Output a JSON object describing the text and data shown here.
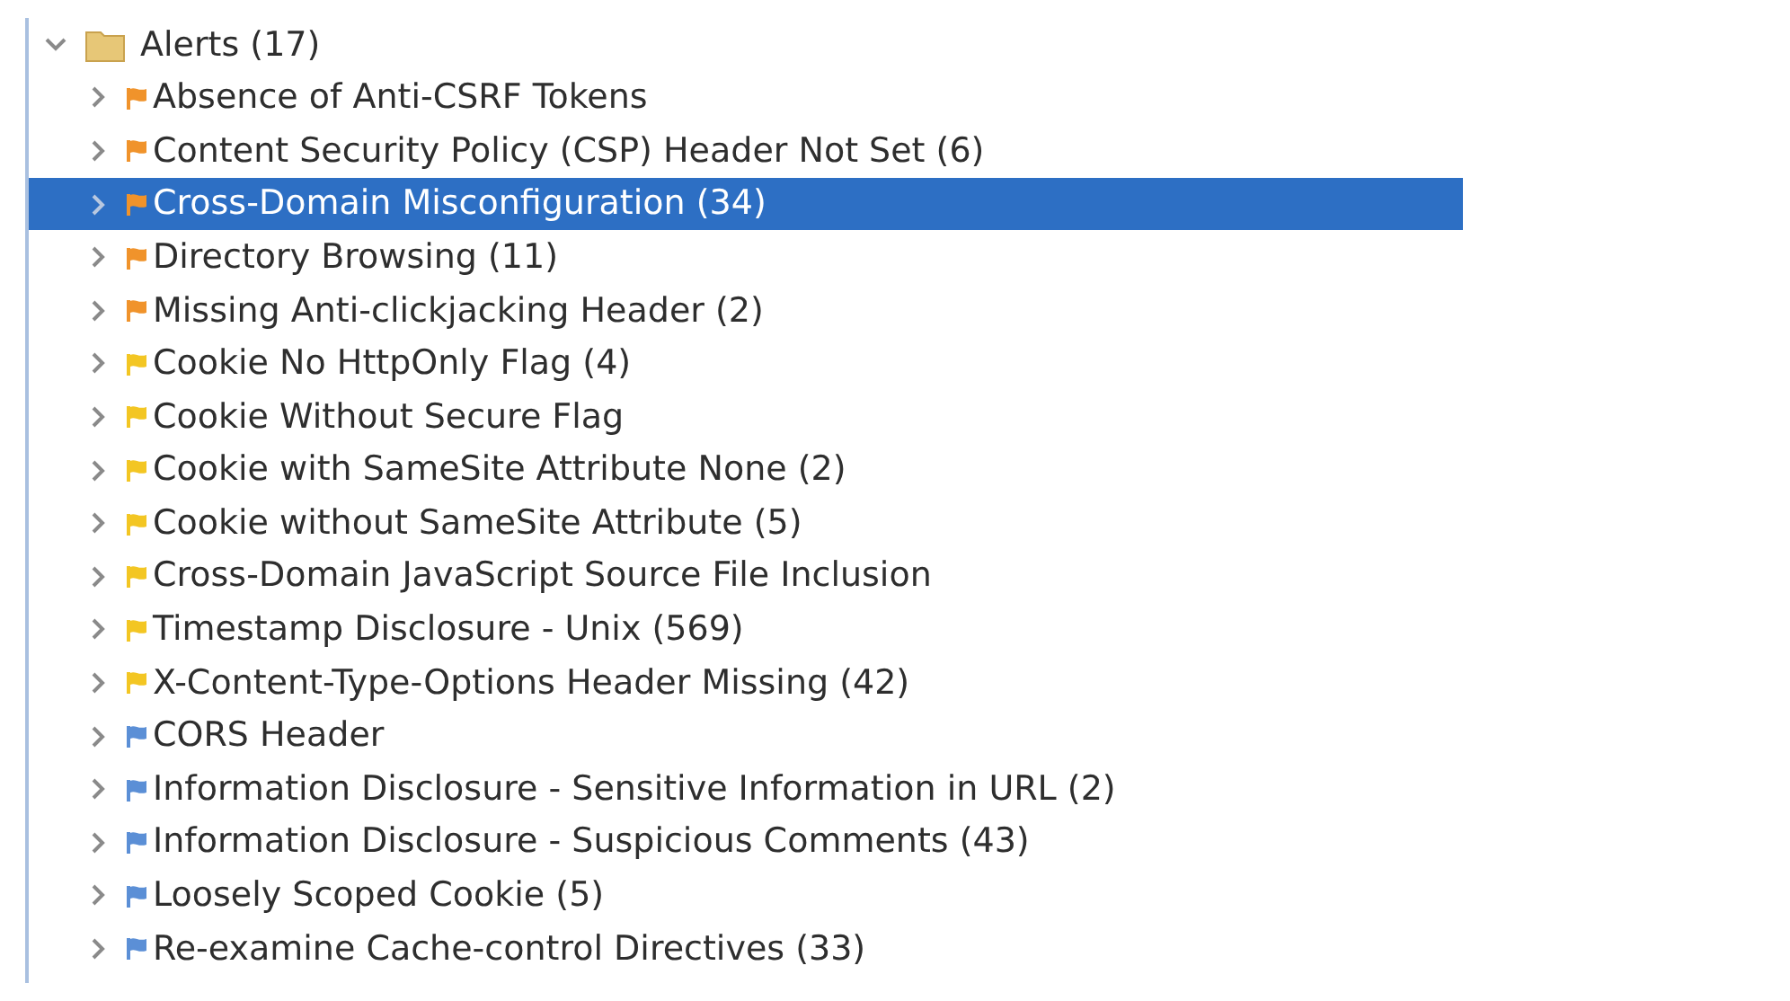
{
  "tree": {
    "label": "Alerts (17)",
    "expanded": true,
    "children": [
      {
        "label": "Absence of Anti-CSRF Tokens",
        "color": "#f0932b",
        "selected": false,
        "expanded": false
      },
      {
        "label": "Content Security Policy (CSP) Header Not Set (6)",
        "color": "#f0932b",
        "selected": false,
        "expanded": false
      },
      {
        "label": "Cross-Domain Misconfiguration (34)",
        "color": "#f0932b",
        "selected": true,
        "expanded": false
      },
      {
        "label": "Directory Browsing (11)",
        "color": "#f0932b",
        "selected": false,
        "expanded": false
      },
      {
        "label": "Missing Anti-clickjacking Header (2)",
        "color": "#f0932b",
        "selected": false,
        "expanded": false
      },
      {
        "label": "Cookie No HttpOnly Flag (4)",
        "color": "#f3c623",
        "selected": false,
        "expanded": false
      },
      {
        "label": "Cookie Without Secure Flag",
        "color": "#f3c623",
        "selected": false,
        "expanded": false
      },
      {
        "label": "Cookie with SameSite Attribute None (2)",
        "color": "#f3c623",
        "selected": false,
        "expanded": false
      },
      {
        "label": "Cookie without SameSite Attribute (5)",
        "color": "#f3c623",
        "selected": false,
        "expanded": false
      },
      {
        "label": "Cross-Domain JavaScript Source File Inclusion",
        "color": "#f3c623",
        "selected": false,
        "expanded": false
      },
      {
        "label": "Timestamp Disclosure - Unix (569)",
        "color": "#f3c623",
        "selected": false,
        "expanded": false
      },
      {
        "label": "X-Content-Type-Options Header Missing (42)",
        "color": "#f3c623",
        "selected": false,
        "expanded": false
      },
      {
        "label": "CORS Header",
        "color": "#5b8fd6",
        "selected": false,
        "expanded": false
      },
      {
        "label": "Information Disclosure - Sensitive Information in URL (2)",
        "color": "#5b8fd6",
        "selected": false,
        "expanded": false
      },
      {
        "label": "Information Disclosure - Suspicious Comments (43)",
        "color": "#5b8fd6",
        "selected": false,
        "expanded": false
      },
      {
        "label": "Loosely Scoped Cookie (5)",
        "color": "#5b8fd6",
        "selected": false,
        "expanded": false
      },
      {
        "label": "Re-examine Cache-control Directives (33)",
        "color": "#5b8fd6",
        "selected": false,
        "expanded": false
      }
    ]
  }
}
